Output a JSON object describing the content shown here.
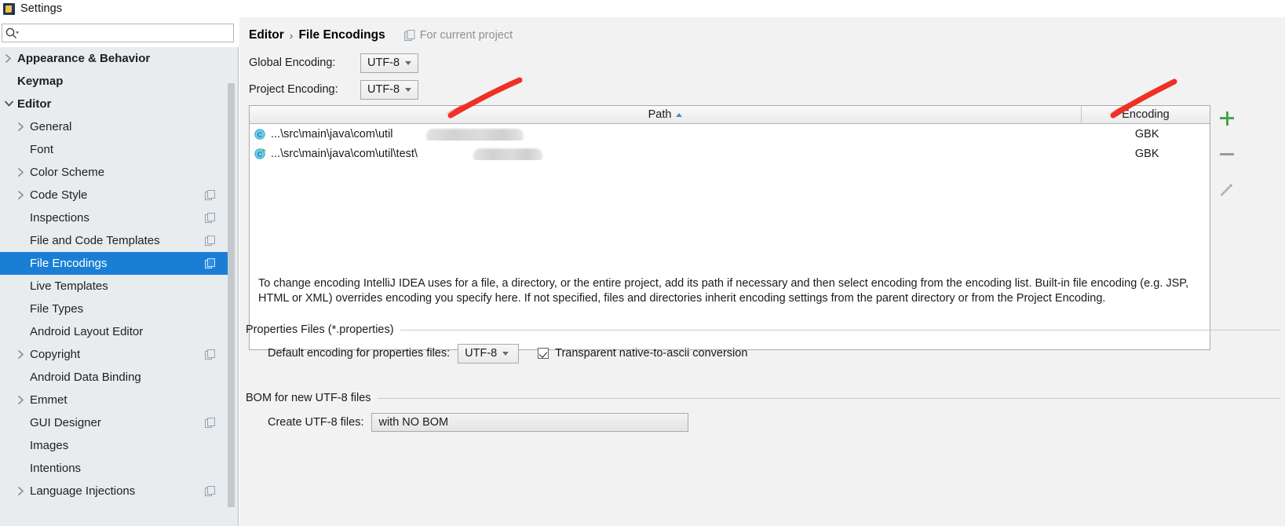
{
  "window": {
    "title": "Settings",
    "app_icon": "intellij-idea-icon"
  },
  "search": {
    "placeholder": "",
    "value": "",
    "icon": "search-icon"
  },
  "sidebar": {
    "items": [
      {
        "label": "Appearance & Behavior",
        "arrow": "collapsed",
        "bold": true,
        "indent": 0,
        "badge": false,
        "selected": false
      },
      {
        "label": "Keymap",
        "arrow": "none",
        "bold": true,
        "indent": 0,
        "badge": false,
        "selected": false
      },
      {
        "label": "Editor",
        "arrow": "expanded",
        "bold": true,
        "indent": 0,
        "badge": false,
        "selected": false
      },
      {
        "label": "General",
        "arrow": "collapsed",
        "bold": false,
        "indent": 1,
        "badge": false,
        "selected": false
      },
      {
        "label": "Font",
        "arrow": "none",
        "bold": false,
        "indent": 1,
        "badge": false,
        "selected": false
      },
      {
        "label": "Color Scheme",
        "arrow": "collapsed",
        "bold": false,
        "indent": 1,
        "badge": false,
        "selected": false
      },
      {
        "label": "Code Style",
        "arrow": "collapsed",
        "bold": false,
        "indent": 1,
        "badge": true,
        "selected": false
      },
      {
        "label": "Inspections",
        "arrow": "none",
        "bold": false,
        "indent": 1,
        "badge": true,
        "selected": false
      },
      {
        "label": "File and Code Templates",
        "arrow": "none",
        "bold": false,
        "indent": 1,
        "badge": true,
        "selected": false
      },
      {
        "label": "File Encodings",
        "arrow": "none",
        "bold": false,
        "indent": 1,
        "badge": true,
        "selected": true
      },
      {
        "label": "Live Templates",
        "arrow": "none",
        "bold": false,
        "indent": 1,
        "badge": false,
        "selected": false
      },
      {
        "label": "File Types",
        "arrow": "none",
        "bold": false,
        "indent": 1,
        "badge": false,
        "selected": false
      },
      {
        "label": "Android Layout Editor",
        "arrow": "none",
        "bold": false,
        "indent": 1,
        "badge": false,
        "selected": false
      },
      {
        "label": "Copyright",
        "arrow": "collapsed",
        "bold": false,
        "indent": 1,
        "badge": true,
        "selected": false
      },
      {
        "label": "Android Data Binding",
        "arrow": "none",
        "bold": false,
        "indent": 1,
        "badge": false,
        "selected": false
      },
      {
        "label": "Emmet",
        "arrow": "collapsed",
        "bold": false,
        "indent": 1,
        "badge": false,
        "selected": false
      },
      {
        "label": "GUI Designer",
        "arrow": "none",
        "bold": false,
        "indent": 1,
        "badge": true,
        "selected": false
      },
      {
        "label": "Images",
        "arrow": "none",
        "bold": false,
        "indent": 1,
        "badge": false,
        "selected": false
      },
      {
        "label": "Intentions",
        "arrow": "none",
        "bold": false,
        "indent": 1,
        "badge": false,
        "selected": false
      },
      {
        "label": "Language Injections",
        "arrow": "collapsed",
        "bold": false,
        "indent": 1,
        "badge": true,
        "selected": false
      }
    ]
  },
  "main": {
    "breadcrumb": {
      "root": "Editor",
      "separator": "›",
      "current": "File Encodings"
    },
    "scope": {
      "icon": "project-scope-icon",
      "label": "For current project"
    },
    "global_encoding": {
      "label": "Global Encoding:",
      "value": "UTF-8"
    },
    "project_encoding": {
      "label": "Project Encoding:",
      "value": "UTF-8"
    },
    "table": {
      "columns": [
        "Path",
        "Encoding"
      ],
      "sort_column": "Path",
      "sort_direction": "ascending",
      "rows": [
        {
          "icon": "java-class-icon",
          "path": "...\\src\\main\\java\\com\\util",
          "path_redacted": true,
          "encoding": "GBK"
        },
        {
          "icon": "java-class-run-icon",
          "path": "...\\src\\main\\java\\com\\util\\test\\",
          "path_redacted": true,
          "encoding": "GBK"
        }
      ]
    },
    "tools": {
      "add": "+",
      "remove": "–",
      "edit": "edit-pencil-icon"
    },
    "description": "To change encoding IntelliJ IDEA uses for a file, a directory, or the entire project, add its path if necessary and then select encoding from the encoding list. Built-in file encoding (e.g. JSP, HTML or XML) overrides encoding you specify here. If not specified, files and directories inherit encoding settings from the parent directory or from the Project Encoding.",
    "properties_group": {
      "title": "Properties Files (*.properties)",
      "default_encoding_label": "Default encoding for properties files:",
      "default_encoding_value": "UTF-8",
      "transparent_label": "Transparent native-to-ascii conversion",
      "transparent_checked": true
    },
    "bom_group": {
      "title": "BOM for new UTF-8 files",
      "create_label": "Create UTF-8 files:",
      "create_value": "with NO BOM"
    }
  },
  "annotations": {
    "arrow_color": "#ee3124",
    "arrows": [
      "path-column-arrow",
      "encoding-column-arrow"
    ]
  },
  "colors": {
    "selection": "#1a7fd4",
    "sidebar_bg": "#e8ecef",
    "panel_bg": "#f2f2f2",
    "accent_green": "#4aa24a"
  }
}
